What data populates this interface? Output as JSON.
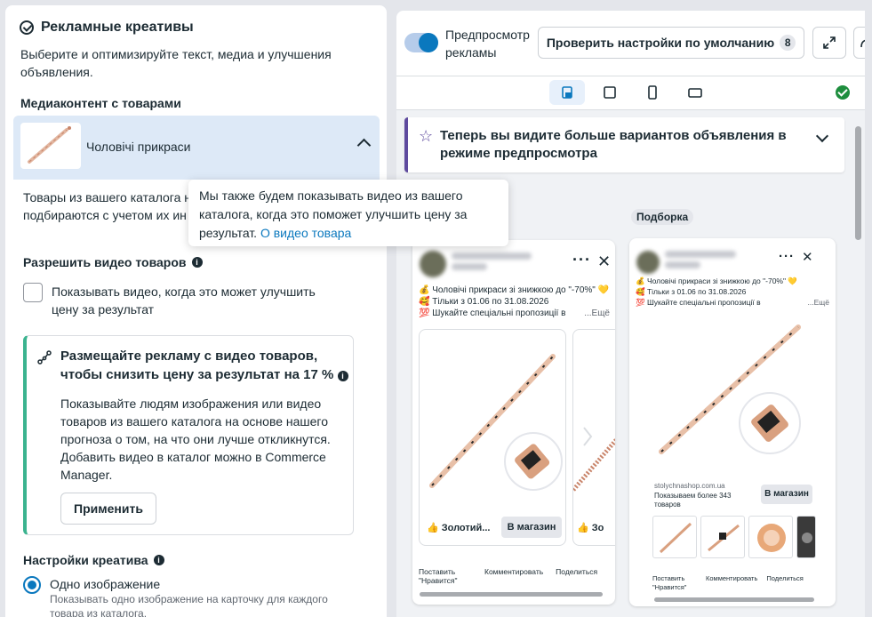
{
  "left": {
    "title": "Рекламные креативы",
    "subtitle": "Выберите и оптимизируйте текст, медиа и улучшения объявления.",
    "media_heading": "Медиаконтент с товарами",
    "product_name": "Чоловічі прикраси",
    "body_text": "Товары из вашего каталога на этих карточках. Товары, к подбираются с учетом их ин",
    "allow_video_heading": "Разрешить видео товаров",
    "checkbox_label": "Показывать видео, когда это может улучшить цену за результат",
    "promo": {
      "title": "Размещайте рекламу с видео товаров, чтобы снизить цену за результат на 17 %",
      "body": "Показывайте людям изображения или видео товаров из вашего каталога на основе нашего прогноза о том, на что они лучше откликнутся. Добавить видео в каталог можно в Commerce Manager.",
      "apply_label": "Применить"
    },
    "creative_settings_heading": "Настройки креатива",
    "radio_label": "Одно изображение",
    "radio_desc": "Показывать одно изображение на карточку для каждого товара из каталога."
  },
  "tooltip": {
    "text": "Мы также будем показывать видео из вашего каталога, когда это поможет улучшить цену за результат.",
    "link": "О видео товара"
  },
  "right": {
    "preview_label": "Предпросмотр рекламы",
    "check_defaults_label": "Проверить настройки по умолчанию",
    "check_defaults_count": "8",
    "notice": "Теперь вы видите больше вариантов объявления в режиме предпросмотра",
    "collection_tag": "Подборка",
    "ad1": {
      "line1": "💰 Чоловічі прикраси зі знижкою до \"-70%\" 💛",
      "line2": "🥰 Тільки з 01.06 по 31.08.2026",
      "line3": "💯 Шукайте спеціальні пропозиції в",
      "more": "...Ещё",
      "product_title": "👍 Золотий...",
      "shop_label": "В магазин",
      "second_title": "👍 Зо",
      "like": "Поставить \"Нравится\"",
      "comment": "Комментировать",
      "share": "Поделиться"
    },
    "ad2": {
      "line1": "💰 Чоловічі прикраси зі знижкою до \"-70%\" 💛",
      "line2": "🥰 Тільки з 01.06 по 31.08.2026",
      "line3": "💯 Шукайте спеціальні пропозиції в",
      "more": "...Ещё",
      "site": "stolychnashop.com.ua",
      "meta": "Показываем более 343 товаров",
      "shop_label": "В магазин",
      "like": "Поставить \"Нравится\"",
      "comment": "Комментировать",
      "share": "Поделиться"
    }
  }
}
